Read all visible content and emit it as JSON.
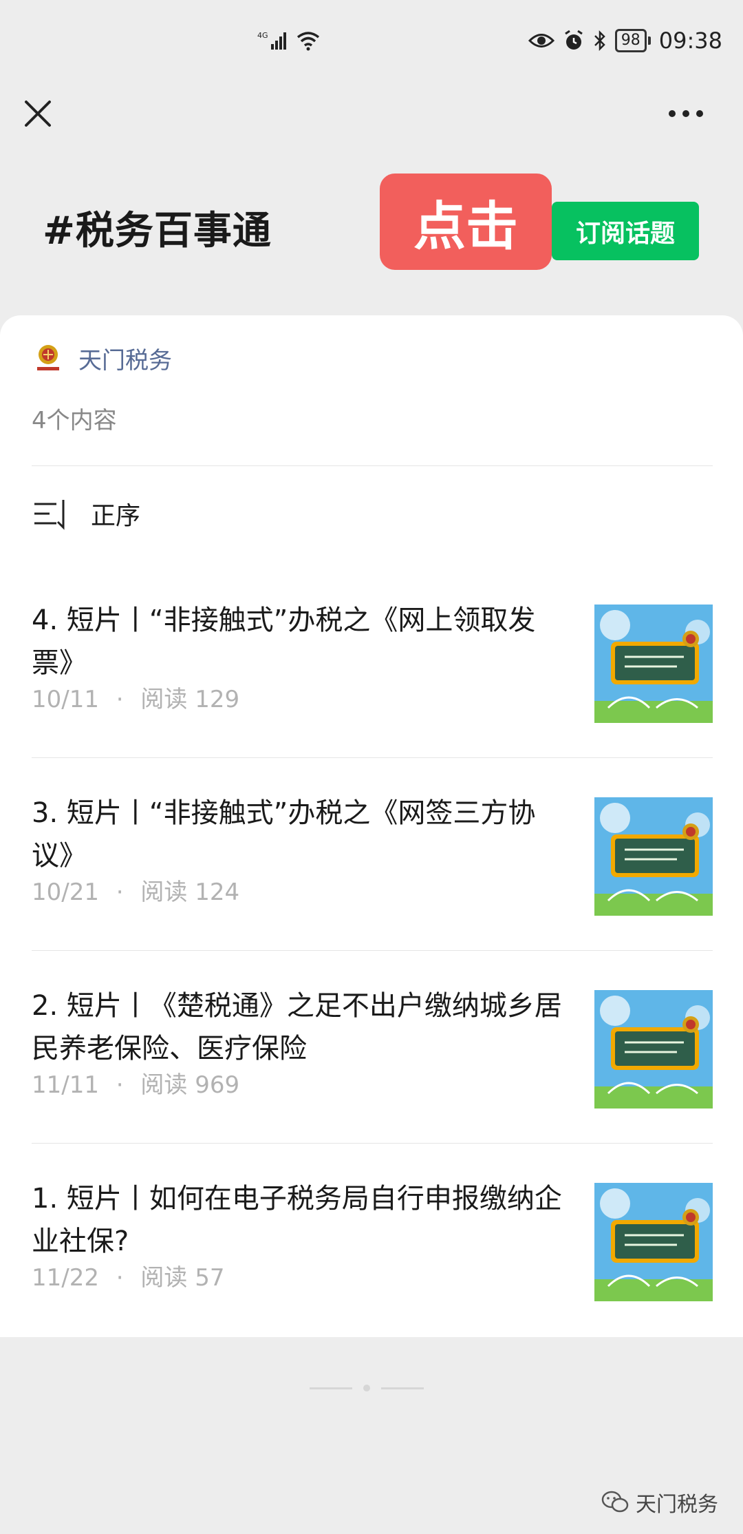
{
  "status_bar": {
    "network": "4G",
    "battery": "98",
    "time": "09:38"
  },
  "nav": {
    "close_icon": "close-icon",
    "more_icon": "more-icon"
  },
  "header": {
    "topic_title": "#税务百事通",
    "overlay_label": "点击",
    "subscribe_label": "订阅话题"
  },
  "account": {
    "name": "天门税务",
    "content_count": "4个内容"
  },
  "sort": {
    "label": "正序",
    "icon": "sort-icon"
  },
  "articles": [
    {
      "title": "4. 短片丨“非接触式”办税之《网上领取发票》",
      "date": "10/11",
      "reads": "阅读 129"
    },
    {
      "title": "3. 短片丨“非接触式”办税之《网签三方协议》",
      "date": "10/21",
      "reads": "阅读 124"
    },
    {
      "title": "2. 短片丨《楚税通》之足不出户缴纳城乡居民养老保险、医疗保险",
      "date": "11/11",
      "reads": "阅读 969"
    },
    {
      "title": "1. 短片丨如何在电子税务局自行申报缴纳企业社保?",
      "date": "11/22",
      "reads": "阅读 57"
    }
  ],
  "meta_separator": "·",
  "watermark": "天门税务",
  "colors": {
    "accent_green": "#07c160",
    "overlay_red": "#f25f5c",
    "link_blue": "#576b95",
    "background": "#ededed"
  }
}
